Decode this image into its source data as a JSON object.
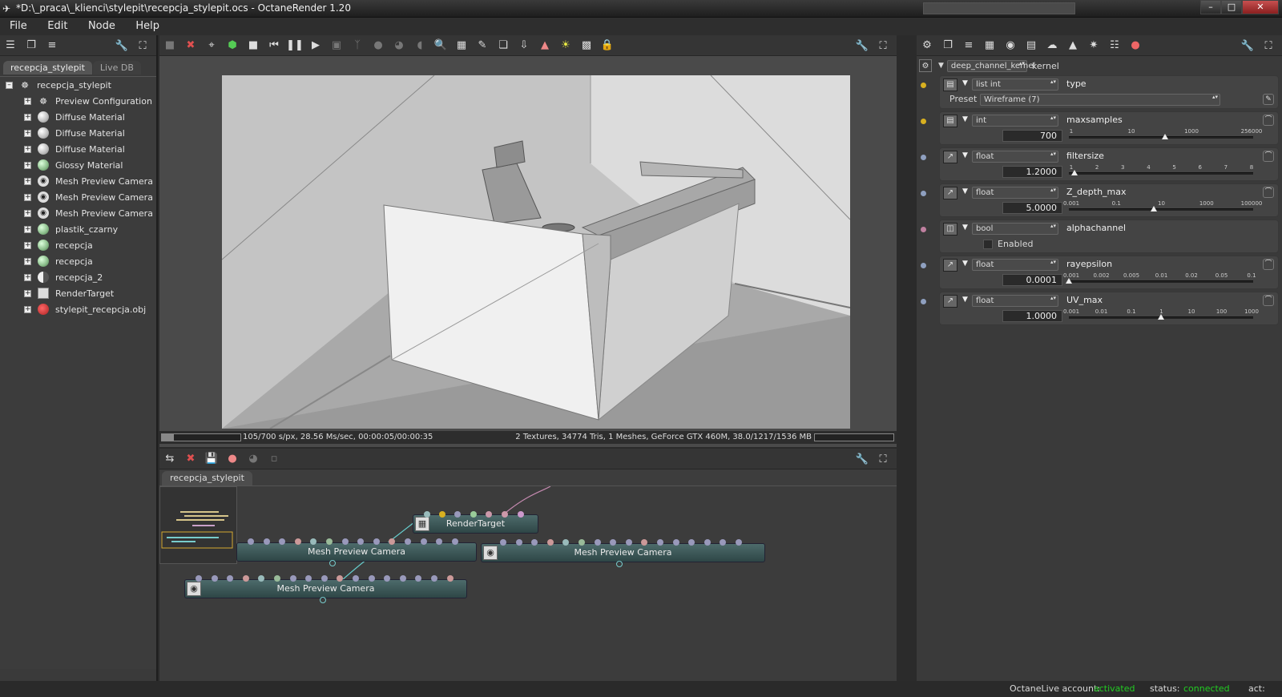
{
  "window": {
    "title": "*D:\\_praca\\_klienci\\stylepit\\recepcja_stylepit.ocs - OctaneRender 1.20",
    "minimize": "–",
    "maximize": "□",
    "close": "✕"
  },
  "menu": [
    "File",
    "Edit",
    "Node",
    "Help"
  ],
  "scene_panel": {
    "tabs": [
      "recepcja_stylepit",
      "Live DB"
    ],
    "root": "recepcja_stylepit",
    "items": [
      {
        "label": "Preview Configuration",
        "icon": "preview-config"
      },
      {
        "label": "Diffuse Material",
        "icon": "sphere"
      },
      {
        "label": "Diffuse Material",
        "icon": "sphere"
      },
      {
        "label": "Diffuse Material",
        "icon": "sphere"
      },
      {
        "label": "Glossy Material",
        "icon": "sphere-green"
      },
      {
        "label": "Mesh Preview Camera",
        "icon": "camera"
      },
      {
        "label": "Mesh Preview Camera",
        "icon": "camera"
      },
      {
        "label": "Mesh Preview Camera",
        "icon": "camera"
      },
      {
        "label": "plastik_czarny",
        "icon": "sphere-green"
      },
      {
        "label": "recepcja",
        "icon": "sphere-green"
      },
      {
        "label": "recepcja",
        "icon": "sphere-green"
      },
      {
        "label": "recepcja_2",
        "icon": "half-sphere"
      },
      {
        "label": "RenderTarget",
        "icon": "render-target"
      },
      {
        "label": "stylepit_recepcja.obj",
        "icon": "mesh"
      }
    ]
  },
  "render": {
    "status_left": "105/700 s/px, 28.56 Ms/sec, 00:00:05/00:00:35",
    "status_right": "2 Textures, 34774 Tris, 1 Meshes, GeForce GTX 460M, 38.0/1217/1536 MB",
    "progress": 0.15
  },
  "graph": {
    "tab": "recepcja_stylepit",
    "nodes": {
      "render_target": "RenderTarget",
      "camera_a": "Mesh Preview Camera",
      "camera_b": "Mesh Preview Camera",
      "camera_c": "Mesh Preview Camera"
    }
  },
  "inspector": {
    "kernel_select": "deep_channel_kernel",
    "kernel_label": "kernel",
    "params": [
      {
        "type": "list int",
        "name": "type",
        "preset_label": "Preset",
        "preset_value": "Wireframe (7)",
        "dot": "#d8b020"
      },
      {
        "type": "int",
        "name": "maxsamples",
        "value": "700",
        "ticks": [
          "1",
          "10",
          "1000",
          "256000"
        ],
        "pos": 0.52,
        "dot": "#d8b020"
      },
      {
        "type": "float",
        "name": "filtersize",
        "value": "1.2000",
        "ticks": [
          "1",
          "2",
          "3",
          "4",
          "5",
          "6",
          "7",
          "8"
        ],
        "pos": 0.03,
        "dot": "#8fa0c0"
      },
      {
        "type": "float",
        "name": "Z_depth_max",
        "value": "5.0000",
        "ticks": [
          "0.001",
          "0.1",
          "10",
          "1000",
          "100000"
        ],
        "pos": 0.46,
        "dot": "#8fa0c0"
      },
      {
        "type": "bool",
        "name": "alphachannel",
        "check_label": "Enabled",
        "dot": "#c080a0"
      },
      {
        "type": "float",
        "name": "rayepsilon",
        "value": "0.0001",
        "ticks": [
          "0.001",
          "0.002",
          "0.005",
          "0.01",
          "0.02",
          "0.05",
          "0.1"
        ],
        "pos": 0.0,
        "dot": "#8fa0c0"
      },
      {
        "type": "float",
        "name": "UV_max",
        "value": "1.0000",
        "ticks": [
          "0.001",
          "0.01",
          "0.1",
          "1",
          "10",
          "100",
          "1000"
        ],
        "pos": 0.5,
        "dot": "#8fa0c0"
      }
    ]
  },
  "statusbar": {
    "account_label": "OctaneLive account:",
    "account_value": "activated",
    "status_label": "status:",
    "status_value": "connected",
    "act_label": "act:"
  }
}
